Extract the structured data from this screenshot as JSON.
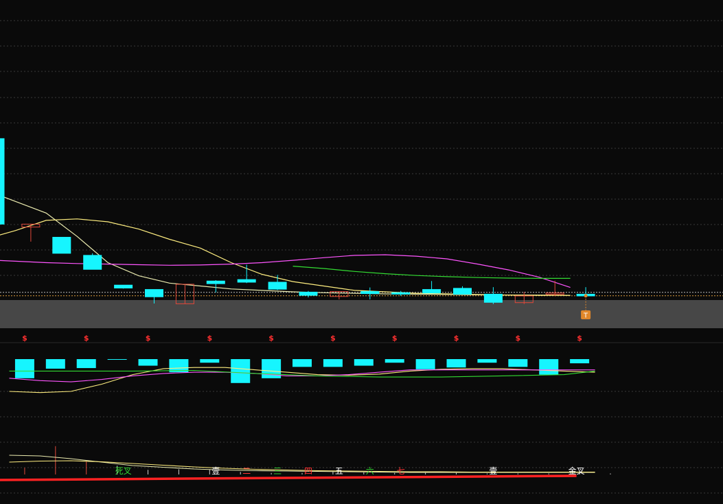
{
  "colors": {
    "background": "#0a0a0a",
    "grid": "#3a3a3a",
    "band": "#474747",
    "bull": "#e0483a",
    "bear": "#16f5ff",
    "ma_fast": "#ececb0",
    "ma_slow": "#ffee80",
    "ma_magenta": "#ff55ff",
    "ma_green": "#33dd33",
    "baseline": "#ff2222",
    "marker": "#ff3030",
    "t_badge": "#e0872a"
  },
  "chart_data": [
    {
      "type": "candlestick",
      "panel": "price",
      "grid": true,
      "ylim": [
        0,
        100
      ],
      "candles": [
        {
          "o": 52.5,
          "h": 52.5,
          "l": 23.2,
          "c": 23.2
        },
        {
          "o": 22.2,
          "h": 21.3,
          "l": 17.2,
          "c": 23.2
        },
        {
          "o": 18.7,
          "h": 16.8,
          "l": 13.2,
          "c": 13.2
        },
        {
          "o": 12.5,
          "h": 13.2,
          "l": 7.7,
          "c": 7.7
        },
        {
          "o": 2.3,
          "h": 2.2,
          "l": 1.1,
          "c": 1.3
        },
        {
          "o": 0.8,
          "h": 0.8,
          "l": -4.0,
          "c": -1.7
        },
        {
          "o": -4.1,
          "h": 2.6,
          "l": -4.1,
          "c": 2.6
        },
        {
          "o": 3.7,
          "h": 4.0,
          "l": -0.2,
          "c": 2.8
        },
        {
          "o": 4.2,
          "h": 9.3,
          "l": 3.0,
          "c": 3.3
        },
        {
          "o": 3.3,
          "h": 5.8,
          "l": 0.6,
          "c": 0.9
        },
        {
          "o": -0.1,
          "h": 0.3,
          "l": -1.9,
          "c": -1.2
        },
        {
          "o": -1.6,
          "h": 0.1,
          "l": -2.6,
          "c": 0.1
        },
        {
          "o": 0.1,
          "h": 1.5,
          "l": -2.6,
          "c": -0.6
        },
        {
          "o": -0.3,
          "h": 0.3,
          "l": -1.4,
          "c": -0.6
        },
        {
          "o": 0.8,
          "h": 3.7,
          "l": -0.4,
          "c": -0.4
        },
        {
          "o": 1.2,
          "h": 1.9,
          "l": -0.8,
          "c": -0.8
        },
        {
          "o": -0.8,
          "h": 1.6,
          "l": -4.2,
          "c": -3.6
        },
        {
          "o": -3.7,
          "h": 0.0,
          "l": -4.2,
          "c": -1.4
        },
        {
          "o": -0.7,
          "h": 3.8,
          "l": -1.5,
          "c": -0.4
        },
        {
          "o": -0.8,
          "h": 1.6,
          "l": -1.9,
          "c": -1.4
        }
      ],
      "lines": [
        {
          "color": "ma_fast",
          "points": [
            [
              -0.5,
              35
            ],
            [
              0.5,
              31
            ],
            [
              1.5,
              27
            ],
            [
              2.5,
              19
            ],
            [
              3.5,
              10
            ],
            [
              4.5,
              5.5
            ],
            [
              5.5,
              3
            ],
            [
              6.5,
              2
            ],
            [
              7.5,
              1
            ],
            [
              8.5,
              0.5
            ],
            [
              9.5,
              0
            ],
            [
              10.5,
              -0.3
            ],
            [
              11.5,
              -0.5
            ],
            [
              12.5,
              -0.7
            ],
            [
              13.5,
              -0.8
            ],
            [
              14.5,
              -0.9
            ],
            [
              15.5,
              -1
            ],
            [
              16.5,
              -1.1
            ],
            [
              17.5,
              -1.1
            ],
            [
              18.5,
              -1.2
            ]
          ]
        },
        {
          "color": "ma_slow",
          "points": [
            [
              -0.5,
              18
            ],
            [
              0.5,
              21
            ],
            [
              1.5,
              24.5
            ],
            [
              2.5,
              25
            ],
            [
              3.5,
              24
            ],
            [
              4.5,
              21.5
            ],
            [
              5.5,
              18
            ],
            [
              6.5,
              15
            ],
            [
              7.5,
              10
            ],
            [
              8.5,
              6
            ],
            [
              9.5,
              3.5
            ],
            [
              10.5,
              2
            ],
            [
              11.5,
              0.5
            ],
            [
              12.5,
              0
            ],
            [
              13.5,
              -0.5
            ],
            [
              14.5,
              -0.7
            ],
            [
              15.5,
              -0.9
            ],
            [
              16.5,
              -1.1
            ],
            [
              17.5,
              -1.2
            ],
            [
              18.5,
              -1.2
            ]
          ]
        },
        {
          "color": "ma_magenta",
          "points": [
            [
              -0.5,
              11
            ],
            [
              0.5,
              10.5
            ],
            [
              1.5,
              10
            ],
            [
              2.5,
              9.7
            ],
            [
              3.5,
              9.5
            ],
            [
              4.5,
              9.3
            ],
            [
              5.5,
              9.1
            ],
            [
              6.5,
              9.2
            ],
            [
              7.5,
              9.5
            ],
            [
              8.5,
              10
            ],
            [
              9.5,
              10.8
            ],
            [
              10.5,
              11.7
            ],
            [
              11.5,
              12.5
            ],
            [
              12.5,
              12.7
            ],
            [
              13.5,
              12.2
            ],
            [
              14.5,
              11.3
            ],
            [
              15.5,
              9.5
            ],
            [
              16.5,
              7.5
            ],
            [
              17.5,
              5
            ],
            [
              18.5,
              1.5
            ]
          ]
        },
        {
          "color": "ma_green",
          "points": [
            [
              9.5,
              8.8
            ],
            [
              10.5,
              8
            ],
            [
              11.5,
              7
            ],
            [
              12.5,
              6.2
            ],
            [
              13.5,
              5.6
            ],
            [
              14.5,
              5.2
            ],
            [
              15.5,
              4.9
            ],
            [
              16.5,
              4.7
            ],
            [
              17.5,
              4.6
            ],
            [
              18.5,
              4.6
            ]
          ]
        }
      ],
      "price_line": -1.35,
      "marker_symbol": "$",
      "badge_text": "T"
    },
    {
      "type": "bar",
      "panel": "oscillator",
      "ylim": [
        -30,
        8
      ],
      "values": [
        -16,
        -8,
        -7.5,
        -0.5,
        -5.5,
        -11,
        -3,
        -20,
        -16,
        -6.5,
        -6.5,
        -5.5,
        -3,
        -8.5,
        -7,
        -3,
        -6.5,
        -13,
        -3.5
      ],
      "lines": [
        {
          "color": "ma_slow",
          "points": [
            [
              -0.5,
              -27
            ],
            [
              0.5,
              -28
            ],
            [
              1.5,
              -27
            ],
            [
              2.5,
              -21
            ],
            [
              3.5,
              -13
            ],
            [
              4.5,
              -8
            ],
            [
              5.5,
              -7
            ],
            [
              6.5,
              -7
            ],
            [
              7.5,
              -9
            ],
            [
              8.5,
              -11
            ],
            [
              9.5,
              -13
            ],
            [
              10.5,
              -13.5
            ],
            [
              11.5,
              -12.5
            ],
            [
              12.5,
              -10
            ],
            [
              13.5,
              -8.5
            ],
            [
              14.5,
              -8
            ],
            [
              15.5,
              -8
            ],
            [
              16.5,
              -9
            ],
            [
              17.5,
              -10
            ],
            [
              18.5,
              -11
            ]
          ]
        },
        {
          "color": "ma_magenta",
          "points": [
            [
              -0.5,
              -16
            ],
            [
              0.5,
              -18
            ],
            [
              1.5,
              -19
            ],
            [
              2.5,
              -17
            ],
            [
              3.5,
              -14
            ],
            [
              4.5,
              -12
            ],
            [
              5.5,
              -11
            ],
            [
              6.5,
              -11
            ],
            [
              7.5,
              -12
            ],
            [
              8.5,
              -14
            ],
            [
              9.5,
              -14
            ],
            [
              10.5,
              -13
            ],
            [
              11.5,
              -11
            ],
            [
              12.5,
              -9
            ],
            [
              13.5,
              -9
            ],
            [
              14.5,
              -9
            ],
            [
              15.5,
              -9
            ],
            [
              16.5,
              -9
            ],
            [
              17.5,
              -9
            ],
            [
              18.5,
              -9
            ]
          ]
        },
        {
          "color": "ma_green",
          "points": [
            [
              -0.5,
              -10
            ],
            [
              1.5,
              -10
            ],
            [
              3.5,
              -10
            ],
            [
              5.5,
              -9.5
            ],
            [
              7.5,
              -12
            ],
            [
              9.5,
              -14
            ],
            [
              11.5,
              -15
            ],
            [
              13.5,
              -15
            ],
            [
              15.5,
              -14
            ],
            [
              17.5,
              -13
            ],
            [
              18.5,
              -10
            ]
          ]
        }
      ]
    },
    {
      "type": "line",
      "panel": "volume",
      "ylim": [
        0,
        10
      ],
      "spikes": [
        1.3,
        5.5,
        2.6,
        1.7,
        0.9,
        1,
        1,
        0.5,
        0.3,
        0.3,
        0.6,
        0.4,
        0.3,
        0.3,
        0.3,
        0.2,
        0.2,
        0.2,
        0.2,
        0.2
      ],
      "lines": [
        {
          "color": "ma_fast",
          "points": [
            [
              -0.5,
              5
            ],
            [
              0.5,
              4.8
            ],
            [
              1.5,
              4
            ],
            [
              2.5,
              3
            ],
            [
              3.5,
              2
            ],
            [
              4.5,
              1.5
            ],
            [
              5.5,
              1
            ],
            [
              6.5,
              0.7
            ],
            [
              7.5,
              0.5
            ],
            [
              8.5,
              0.4
            ],
            [
              9.5,
              0.3
            ],
            [
              10.5,
              0.2
            ],
            [
              11.5,
              0.1
            ],
            [
              12.5,
              0
            ],
            [
              13.5,
              0
            ],
            [
              14.5,
              0
            ],
            [
              15.5,
              0
            ],
            [
              16.5,
              0
            ],
            [
              17.5,
              0
            ],
            [
              18.5,
              0
            ]
          ]
        },
        {
          "color": "ma_slow",
          "points": [
            [
              -0.5,
              3
            ],
            [
              0.5,
              3.3
            ],
            [
              1.5,
              3.4
            ],
            [
              2.5,
              3.1
            ],
            [
              3.5,
              2.6
            ],
            [
              4.5,
              2.1
            ],
            [
              5.5,
              1.6
            ],
            [
              6.5,
              1.2
            ],
            [
              7.5,
              0.9
            ],
            [
              8.5,
              0.7
            ],
            [
              9.5,
              0.5
            ],
            [
              10.5,
              0.4
            ],
            [
              11.5,
              0.3
            ],
            [
              12.5,
              0.2
            ],
            [
              13.5,
              0.2
            ],
            [
              14.5,
              0.1
            ],
            [
              15.5,
              0.1
            ],
            [
              16.5,
              0.1
            ],
            [
              17.5,
              0.1
            ],
            [
              18.5,
              0.1
            ]
          ]
        }
      ],
      "labels": [
        {
          "text": "死叉",
          "at": 4.0,
          "color": "ma_green"
        },
        {
          "text": "壹",
          "at": 7.0,
          "color": "#ffffff"
        },
        {
          "text": "二",
          "at": 8.0,
          "color": "#ff3333"
        },
        {
          "text": "三",
          "at": 9.0,
          "color": "#33dd33"
        },
        {
          "text": "四",
          "at": 10.0,
          "color": "#ff3333"
        },
        {
          "text": "五",
          "at": 11.0,
          "color": "#ffffff"
        },
        {
          "text": "六",
          "at": 12.0,
          "color": "#33dd33"
        },
        {
          "text": "七",
          "at": 13.0,
          "color": "#ff3333"
        },
        {
          "text": "壹",
          "at": 16.0,
          "color": "#ffffff"
        },
        {
          "text": "金叉",
          "at": 18.7,
          "color": "#ffffff"
        }
      ]
    }
  ]
}
